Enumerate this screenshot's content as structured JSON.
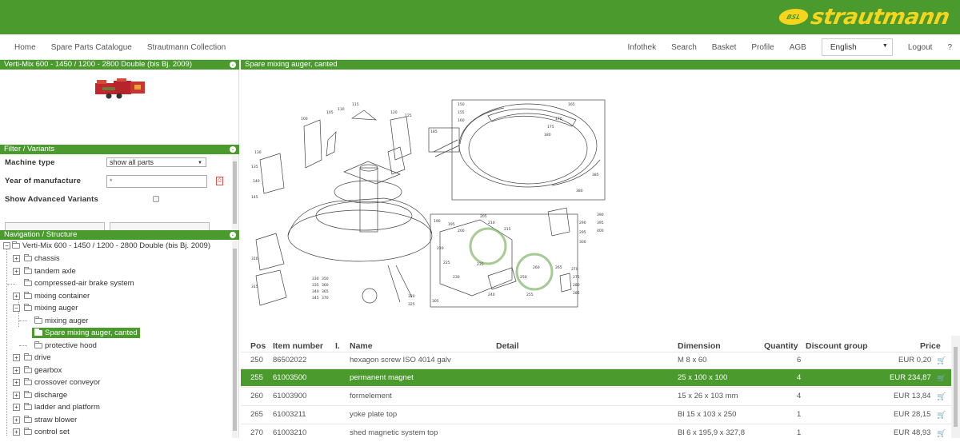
{
  "brand": {
    "logo_badge": "BSL",
    "logo_text": "strautmann"
  },
  "nav": {
    "left": [
      "Home",
      "Spare Parts Catalogue",
      "Strautmann Collection"
    ],
    "right": [
      "Infothek",
      "Search",
      "Basket",
      "Profile",
      "AGB"
    ],
    "language": "English",
    "logout": "Logout",
    "help": "?"
  },
  "machine_panel": {
    "title": "Verti-Mix 600 - 1450 / 1200 - 2800 Double (bis Bj. 2009)"
  },
  "filter": {
    "title": "Filter / Variants",
    "machine_type_label": "Machine type",
    "machine_type_value": "show all parts",
    "year_label": "Year of manufacture",
    "year_value": "*",
    "advanced_label": "Show Advanced Variants"
  },
  "navigation": {
    "title": "Navigation / Structure",
    "root": "Verti-Mix 600 - 1450 / 1200 - 2800 Double (bis Bj. 2009)",
    "items": [
      {
        "label": "chassis"
      },
      {
        "label": "tandem axle"
      },
      {
        "label": "compressed-air brake system"
      },
      {
        "label": "mixing container"
      },
      {
        "label": "mixing auger"
      },
      {
        "label": "mixing auger"
      },
      {
        "label": "Spare mixing auger, canted"
      },
      {
        "label": "protective hood"
      },
      {
        "label": "drive"
      },
      {
        "label": "gearbox"
      },
      {
        "label": "crossover conveyor"
      },
      {
        "label": "discharge"
      },
      {
        "label": "ladder and platform"
      },
      {
        "label": "straw blower"
      },
      {
        "label": "control set"
      }
    ]
  },
  "content": {
    "title": "Spare mixing auger, canted",
    "drawing": {
      "callouts": [
        "100",
        "105",
        "110",
        "115",
        "120",
        "125",
        "130",
        "135",
        "140",
        "145",
        "150",
        "155",
        "160",
        "165",
        "170",
        "175",
        "180",
        "185",
        "190",
        "195",
        "200",
        "205",
        "210",
        "215",
        "220",
        "225",
        "230",
        "235",
        "240",
        "250",
        "255",
        "260",
        "265",
        "270",
        "275",
        "280",
        "285",
        "290",
        "295",
        "300",
        "305",
        "310",
        "315",
        "320",
        "325",
        "330",
        "335",
        "340",
        "345",
        "350",
        "360",
        "365",
        "370",
        "380",
        "385",
        "390",
        "395",
        "400"
      ]
    }
  },
  "table": {
    "headers": {
      "pos": "Pos",
      "item": "Item number",
      "l": "I.",
      "name": "Name",
      "detail": "Detail",
      "dimension": "Dimension",
      "quantity": "Quantity",
      "discount": "Discount group",
      "price": "Price"
    },
    "rows": [
      {
        "pos": "250",
        "item": "86502022",
        "name": "hexagon screw ISO 4014 galv",
        "dimension": "M 8 x 60",
        "quantity": "6",
        "price": "EUR 0,20"
      },
      {
        "pos": "255",
        "item": "61003500",
        "name": "permanent magnet",
        "dimension": "25 x 100 x 100",
        "quantity": "4",
        "price": "EUR 234,87"
      },
      {
        "pos": "260",
        "item": "61003900",
        "name": "formelement",
        "dimension": "15 x 26 x 103 mm",
        "quantity": "4",
        "price": "EUR 13,84"
      },
      {
        "pos": "265",
        "item": "61003211",
        "name": "yoke plate top",
        "dimension": "Bl 15 x 103 x 250",
        "quantity": "1",
        "price": "EUR 28,15"
      },
      {
        "pos": "270",
        "item": "61003210",
        "name": "shed magnetic system top",
        "dimension": "Bl 6 x 195,9 x 327,8",
        "quantity": "1",
        "price": "EUR 48,93"
      }
    ]
  }
}
